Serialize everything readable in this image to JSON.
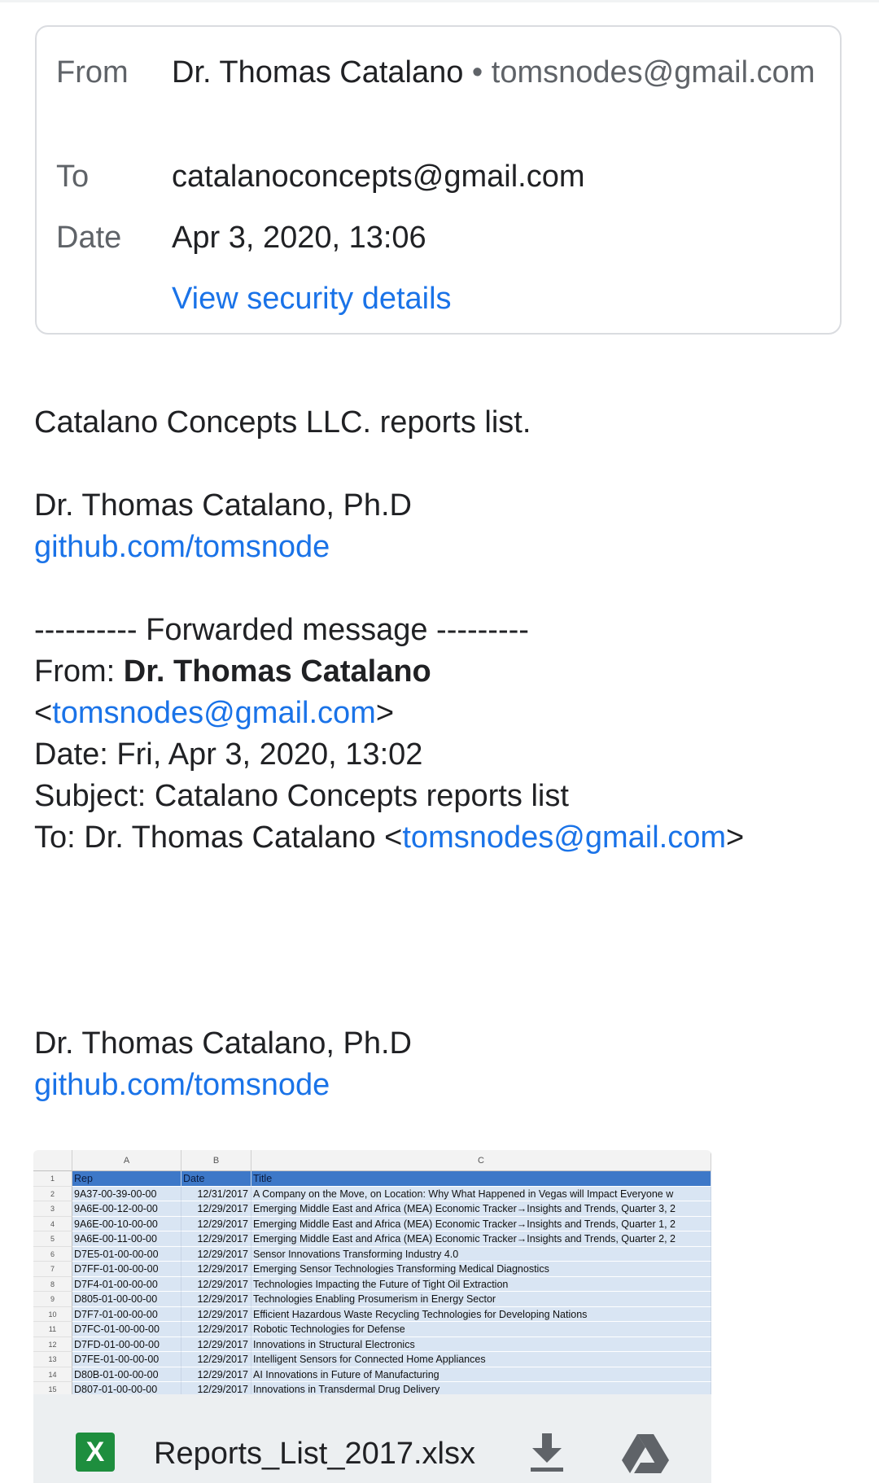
{
  "header": {
    "from_label": "From",
    "from_name": "Dr. Thomas Catalano",
    "from_sep": " • ",
    "from_email": "tomsnodes@gmail.com",
    "to_label": "To",
    "to_value": "catalanoconcepts@gmail.com",
    "date_label": "Date",
    "date_value": "Apr 3, 2020, 13:06",
    "security_link": "View security details"
  },
  "body": {
    "intro": "Catalano Concepts LLC. reports list.",
    "sig1_name": "Dr. Thomas Catalano, Ph.D",
    "sig1_link": "github.com/tomsnode",
    "fwd_divider": "---------- Forwarded message ---------",
    "fwd_from_label": "From: ",
    "fwd_from_name": "Dr. Thomas Catalano",
    "fwd_from_email_open": "<",
    "fwd_from_email": "tomsnodes@gmail.com",
    "fwd_from_email_close": ">",
    "fwd_date": "Date: Fri, Apr 3, 2020, 13:02",
    "fwd_subject": "Subject: Catalano Concepts reports list",
    "fwd_to_prefix": "To: Dr. Thomas Catalano <",
    "fwd_to_email": "tomsnodes@gmail.com",
    "fwd_to_suffix": ">",
    "sig2_name": "Dr. Thomas Catalano, Ph.D",
    "sig2_link": "github.com/tomsnode"
  },
  "attachment": {
    "filename": "Reports_List_2017.xlsx",
    "file_icon": "excel-icon",
    "file_icon_letter": "X",
    "download_icon": "download-icon",
    "drive_icon": "google-drive-icon",
    "columns": [
      "A",
      "B",
      "C"
    ],
    "rows": [
      {
        "num": "1",
        "rep": "Rep",
        "date": "Date",
        "title": "Title"
      },
      {
        "num": "2",
        "rep": "9A37-00-39-00-00",
        "date": "12/31/2017",
        "title": "A Company on the Move, on Location: Why What Happened in Vegas will Impact Everyone w"
      },
      {
        "num": "3",
        "rep": "9A6E-00-12-00-00",
        "date": "12/29/2017",
        "title": "Emerging Middle East and Africa (MEA) Economic Tracker→Insights and Trends, Quarter 3, 2"
      },
      {
        "num": "4",
        "rep": "9A6E-00-10-00-00",
        "date": "12/29/2017",
        "title": "Emerging Middle East and Africa (MEA) Economic Tracker→Insights and Trends, Quarter 1, 2"
      },
      {
        "num": "5",
        "rep": "9A6E-00-11-00-00",
        "date": "12/29/2017",
        "title": "Emerging Middle East and Africa (MEA) Economic Tracker→Insights and Trends, Quarter 2, 2"
      },
      {
        "num": "6",
        "rep": "D7E5-01-00-00-00",
        "date": "12/29/2017",
        "title": "Sensor Innovations Transforming Industry 4.0"
      },
      {
        "num": "7",
        "rep": "D7FF-01-00-00-00",
        "date": "12/29/2017",
        "title": "Emerging Sensor Technologies Transforming Medical Diagnostics"
      },
      {
        "num": "8",
        "rep": "D7F4-01-00-00-00",
        "date": "12/29/2017",
        "title": "Technologies Impacting the Future of Tight Oil Extraction"
      },
      {
        "num": "9",
        "rep": "D805-01-00-00-00",
        "date": "12/29/2017",
        "title": "Technologies Enabling Prosumerism in Energy Sector"
      },
      {
        "num": "10",
        "rep": "D7F7-01-00-00-00",
        "date": "12/29/2017",
        "title": "Efficient Hazardous Waste Recycling Technologies for Developing Nations"
      },
      {
        "num": "11",
        "rep": "D7FC-01-00-00-00",
        "date": "12/29/2017",
        "title": "Robotic Technologies for Defense"
      },
      {
        "num": "12",
        "rep": "D7FD-01-00-00-00",
        "date": "12/29/2017",
        "title": "Innovations in Structural Electronics"
      },
      {
        "num": "13",
        "rep": "D7FE-01-00-00-00",
        "date": "12/29/2017",
        "title": "Intelligent Sensors for Connected Home Appliances"
      },
      {
        "num": "14",
        "rep": "D80B-01-00-00-00",
        "date": "12/29/2017",
        "title": "AI Innovations in Future of Manufacturing"
      },
      {
        "num": "15",
        "rep": "D807-01-00-00-00",
        "date": "12/29/2017",
        "title": "Innovations in Transdermal Drug Delivery"
      }
    ]
  },
  "colors": {
    "link": "#1a73e8",
    "excel_green": "#1e8e3e",
    "sheet_header_blue": "#3d78c8"
  }
}
